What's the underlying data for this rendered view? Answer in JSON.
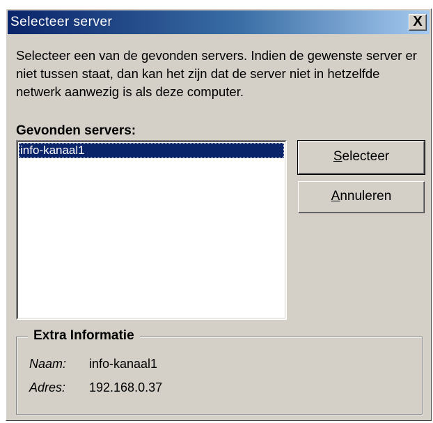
{
  "window": {
    "title": "Selecteer server",
    "close_label": "X"
  },
  "description": "Selecteer een van de gevonden servers. Indien de gewenste server er niet tussen staat, dan kan het zijn dat de server niet in hetzelfde netwerk aanwezig is als deze computer.",
  "servers": {
    "label": "Gevonden servers:",
    "items": [
      "info-kanaal1"
    ],
    "selected_index": 0
  },
  "buttons": {
    "select": {
      "mnemonic": "S",
      "rest": "electeer"
    },
    "cancel": {
      "mnemonic": "A",
      "rest": "nnuleren"
    }
  },
  "extra_info": {
    "title": "Extra Informatie",
    "name_label": "Naam:",
    "name_value": "info-kanaal1",
    "address_label": "Adres:",
    "address_value": "192.168.0.37"
  },
  "colors": {
    "dialog_face": "#d4d0c8",
    "title_active": "#0a246a",
    "selection": "#0a246a"
  }
}
